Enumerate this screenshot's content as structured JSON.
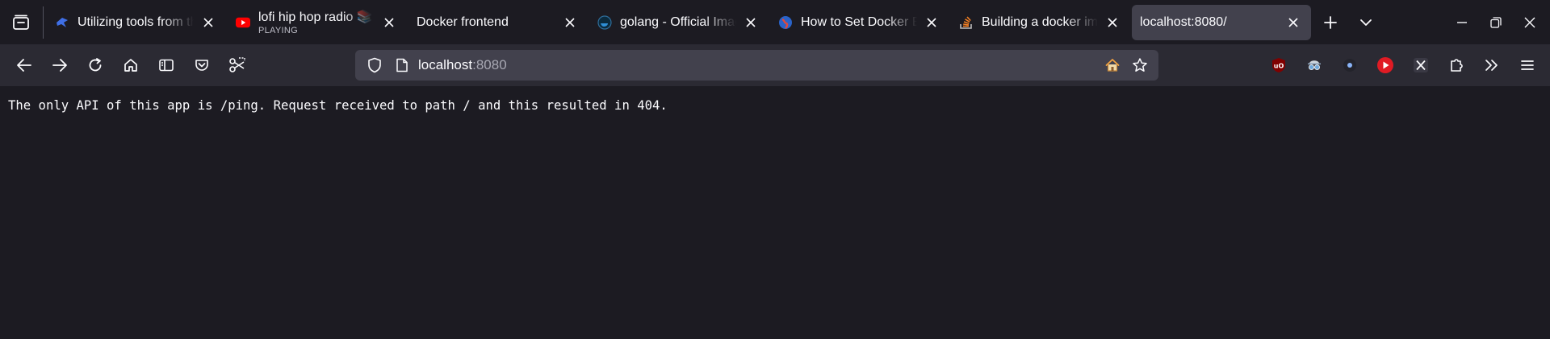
{
  "tabs": [
    {
      "title": "Utilizing tools from the",
      "subtitle": "",
      "icon": "bird-favicon-icon",
      "selected": false
    },
    {
      "title": "lofi hip hop radio 📚 -",
      "subtitle": "PLAYING",
      "icon": "youtube-favicon-icon",
      "selected": false
    },
    {
      "title": "Docker frontend",
      "subtitle": "",
      "icon": "none",
      "selected": false
    },
    {
      "title": "golang - Official Image",
      "subtitle": "",
      "icon": "docker-favicon-icon",
      "selected": false
    },
    {
      "title": "How to Set Docker Env",
      "subtitle": "",
      "icon": "globe-favicon-icon",
      "selected": false
    },
    {
      "title": "Building a docker image",
      "subtitle": "",
      "icon": "stackoverflow-favicon-icon",
      "selected": false
    },
    {
      "title": "localhost:8080/",
      "subtitle": "",
      "icon": "none",
      "selected": true
    }
  ],
  "urlbar": {
    "host": "localhost",
    "port": ":8080"
  },
  "page": {
    "body_text": "The only API of this app is /ping. Request received to path / and this resulted in 404."
  },
  "colors": {
    "tabstrip_bg": "#1c1b22",
    "toolbar_bg": "#2b2a33",
    "selected_tab_bg": "#42414d",
    "content_bg": "#1c1b22",
    "text": "#fbfbfe"
  }
}
